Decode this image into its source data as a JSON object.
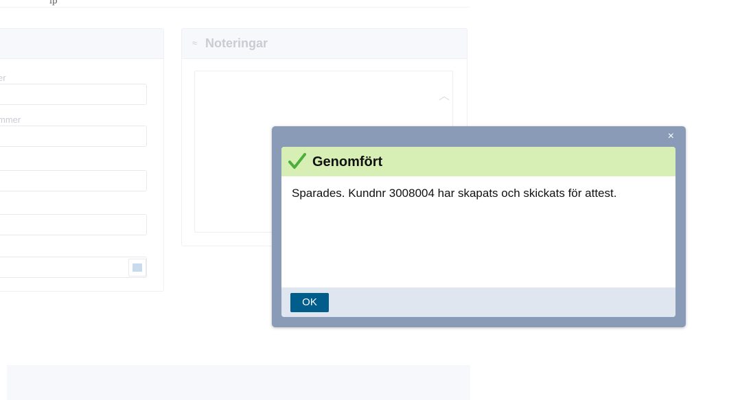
{
  "top_strip": {
    "glyph": "ip"
  },
  "left_panel": {
    "fields": [
      {
        "label_fragment": "er"
      },
      {
        "label_fragment": "mmer"
      }
    ]
  },
  "notes_panel": {
    "title": "Noteringar"
  },
  "dialog": {
    "title": "Genomfört",
    "message": "Sparades. Kundnr 3008004 har skapats och skickats för attest.",
    "ok_label": "OK",
    "close_symbol": "×"
  },
  "colors": {
    "dialog_frame": "#8a9bb7",
    "success_header": "#d7eeb5",
    "check": "#4caf3c",
    "ok_button": "#005d8c",
    "footer": "#dfe6ef"
  }
}
